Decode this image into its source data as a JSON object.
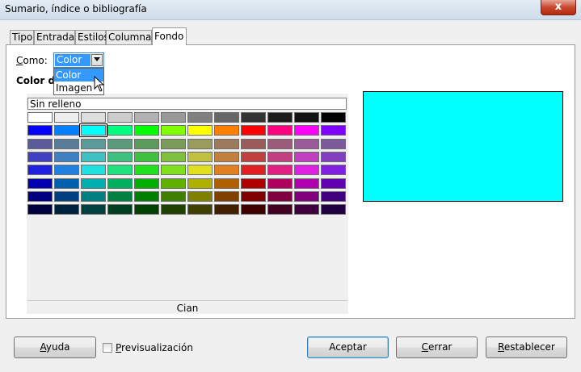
{
  "window": {
    "title": "Sumario, índice o bibliografía",
    "close_glyph": "x"
  },
  "tabs": [
    {
      "label": "Tipo",
      "active": false
    },
    {
      "label": "Entradas",
      "active": false
    },
    {
      "label": "Estilos",
      "active": false
    },
    {
      "label": "Columnas",
      "active": false
    },
    {
      "label": "Fondo",
      "active": true
    }
  ],
  "fondo": {
    "como_label": "Como:",
    "combo_value": "Color",
    "dropdown_options": [
      "Color",
      "Imagen"
    ],
    "section_label": "Color de",
    "no_fill_label": "Sin relleno",
    "selected_color_name": "Cian",
    "preview_color": "#00ffff",
    "palette": [
      [
        "#ffffff",
        "#eeeeee",
        "#dddddd",
        "#cccccc",
        "#b2b2b2",
        "#999999",
        "#808080",
        "#666666",
        "#333333",
        "#1c1c1c",
        "#111111",
        "#000000"
      ],
      [
        "#0000ff",
        "#0080ff",
        "#00ffff",
        "#00ff80",
        "#00ff00",
        "#80ff00",
        "#ffff00",
        "#ff8000",
        "#ff0000",
        "#ff0080",
        "#ff00ff",
        "#8000ff"
      ],
      [
        "#5b5b9b",
        "#5b7b9b",
        "#5b9b9b",
        "#5b9b7b",
        "#5b9b5b",
        "#7b9b5b",
        "#9b9b5b",
        "#9b7b5b",
        "#9b5b5b",
        "#9b5b7b",
        "#9b5b9b",
        "#7b5b9b"
      ],
      [
        "#4040c0",
        "#4080c0",
        "#40c0c0",
        "#40c080",
        "#40c040",
        "#80c040",
        "#c0c040",
        "#c08040",
        "#c04040",
        "#c04080",
        "#c040c0",
        "#8040c0"
      ],
      [
        "#2020e0",
        "#2080e0",
        "#20e0e0",
        "#20e080",
        "#20e020",
        "#80e020",
        "#e0e020",
        "#e08020",
        "#e02020",
        "#e02080",
        "#e020e0",
        "#8020e0"
      ],
      [
        "#0000b0",
        "#0060b0",
        "#00b0b0",
        "#00b060",
        "#00b000",
        "#60b000",
        "#b0b000",
        "#b06000",
        "#b00000",
        "#b00060",
        "#b000b0",
        "#6000b0"
      ],
      [
        "#000080",
        "#004080",
        "#008080",
        "#008040",
        "#008000",
        "#408000",
        "#808000",
        "#804000",
        "#800000",
        "#800040",
        "#800080",
        "#400080"
      ],
      [
        "#000040",
        "#002040",
        "#004040",
        "#004020",
        "#004000",
        "#204000",
        "#404000",
        "#402000",
        "#400000",
        "#400020",
        "#400040",
        "#200040"
      ]
    ],
    "selected_swatch": [
      1,
      2
    ]
  },
  "buttons": {
    "help": "Ayuda",
    "preview_checkbox_label": "Previsualización",
    "accept": "Aceptar",
    "close": "Cerrar",
    "reset": "Restablecer"
  }
}
